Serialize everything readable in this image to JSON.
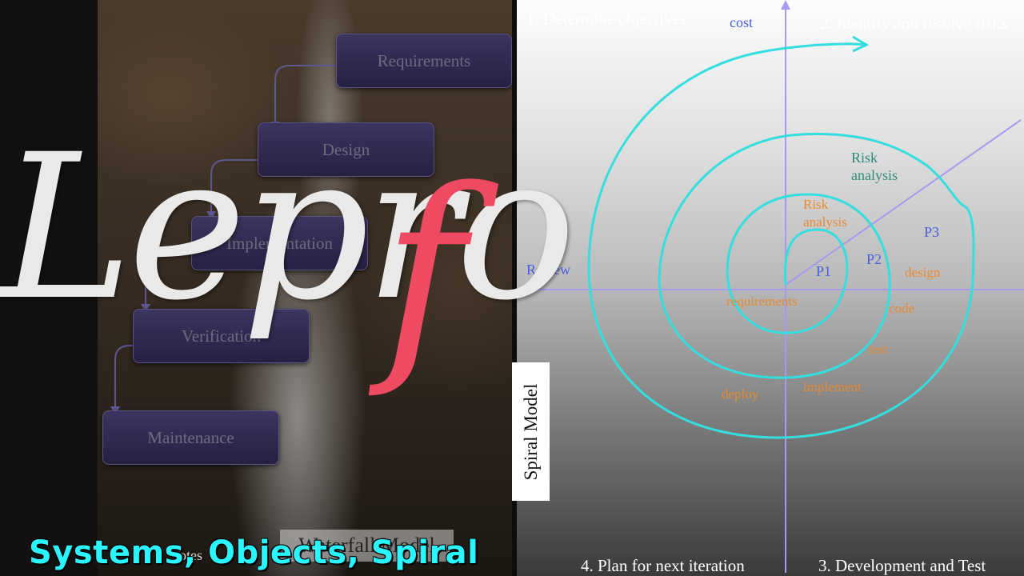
{
  "waterfall": {
    "steps": [
      "Requirements",
      "Design",
      "Implementation",
      "Verification",
      "Maintenance"
    ],
    "label": "Waterfall Model",
    "faint_text": "rotes"
  },
  "spiral": {
    "quadrants": {
      "q1": "1. Determine objectives",
      "q2": "2. Identify and resolve risks",
      "q3": "3. Development and Test",
      "q4": "4. Plan for next iteration"
    },
    "axis_labels": {
      "cost": "cost",
      "review": "Review"
    },
    "phases": {
      "p1": "P1",
      "p2": "P2",
      "p3": "P3"
    },
    "risk_outer": [
      "Risk",
      "analysis"
    ],
    "risk_inner": [
      "Risk",
      "analysis"
    ],
    "activities": {
      "requirements": "requirements",
      "design": "design",
      "code": "code",
      "test": "test",
      "implement": "implement",
      "deploy": "deploy"
    },
    "side_label": "Spiral Model"
  },
  "logo": {
    "main": "Lepro",
    "accent": "f"
  },
  "title": "Systems, Objects, Spiral",
  "colors": {
    "logo_accent": "#ee4a62",
    "title": "#2af6ff",
    "spiral": "#34dede",
    "axes": "#a898ee",
    "phase_text": "#4a5ee0",
    "activity_text": "#e58a32",
    "risk_text": "#2e8a7a"
  }
}
